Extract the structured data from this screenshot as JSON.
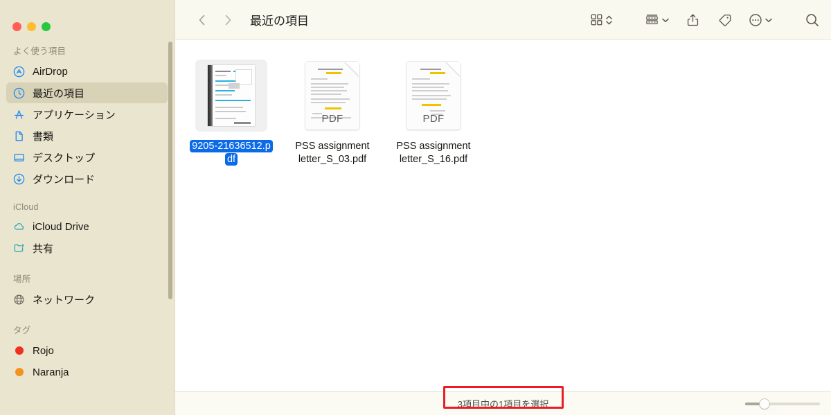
{
  "window": {
    "traffic_lights": [
      {
        "name": "close",
        "color": "#ff5f57"
      },
      {
        "name": "minimize",
        "color": "#febc2e"
      },
      {
        "name": "maximize",
        "color": "#29c840"
      }
    ]
  },
  "toolbar": {
    "back_icon": "chevron-left-icon",
    "forward_icon": "chevron-right-icon",
    "title": "最近の項目",
    "view_icon": "grid-view-icon",
    "view_stepper_icon": "chevron-up-down-icon",
    "group_icon": "group-by-icon",
    "group_chevron_icon": "chevron-down-icon",
    "share_icon": "share-icon",
    "tag_icon": "tag-icon",
    "more_icon": "ellipsis-circle-icon",
    "more_chevron_icon": "chevron-down-icon",
    "search_icon": "search-icon"
  },
  "sidebar": {
    "sections": [
      {
        "title": "よく使う項目",
        "items": [
          {
            "label": "AirDrop",
            "icon": "airdrop-icon",
            "color": "#1a86f0",
            "selected": false
          },
          {
            "label": "最近の項目",
            "icon": "clock-icon",
            "color": "#1a86f0",
            "selected": true
          },
          {
            "label": "アプリケーション",
            "icon": "applications-icon",
            "color": "#1a86f0",
            "selected": false
          },
          {
            "label": "書類",
            "icon": "document-icon",
            "color": "#1a86f0",
            "selected": false
          },
          {
            "label": "デスクトップ",
            "icon": "desktop-icon",
            "color": "#1a86f0",
            "selected": false
          },
          {
            "label": "ダウンロード",
            "icon": "download-icon",
            "color": "#1a86f0",
            "selected": false
          }
        ]
      },
      {
        "title": "iCloud",
        "items": [
          {
            "label": "iCloud Drive",
            "icon": "cloud-icon",
            "color": "#34a9b5",
            "selected": false
          },
          {
            "label": "共有",
            "icon": "shared-folder-icon",
            "color": "#34a9b5",
            "selected": false
          }
        ]
      },
      {
        "title": "場所",
        "items": [
          {
            "label": "ネットワーク",
            "icon": "globe-icon",
            "color": "#6b6a60",
            "selected": false
          }
        ]
      },
      {
        "title": "タグ",
        "items": [
          {
            "label": "Rojo",
            "icon": "tag-dot-icon",
            "color": "#f02f20",
            "selected": false
          },
          {
            "label": "Naranja",
            "icon": "tag-dot-icon",
            "color": "#f5911e",
            "selected": false
          }
        ]
      }
    ]
  },
  "files": [
    {
      "name_line1": "9205-21636512.p",
      "name_line2": "df",
      "full_name": "9205-21636512.pdf",
      "kind": "pdf-preview",
      "selected": true
    },
    {
      "name_line1": "PSS assignment",
      "name_line2": "letter_S_03.pdf",
      "full_name": "PSS assignment letter_S_03.pdf",
      "kind": "pdf-generic",
      "badge": "PDF",
      "selected": false
    },
    {
      "name_line1": "PSS assignment",
      "name_line2": "letter_S_16.pdf",
      "full_name": "PSS assignment letter_S_16.pdf",
      "kind": "pdf-generic",
      "badge": "PDF",
      "selected": false
    }
  ],
  "statusbar": {
    "text": "3項目中の1項目を選択",
    "highlight_color": "#ec1c24",
    "zoom_value": 25
  }
}
